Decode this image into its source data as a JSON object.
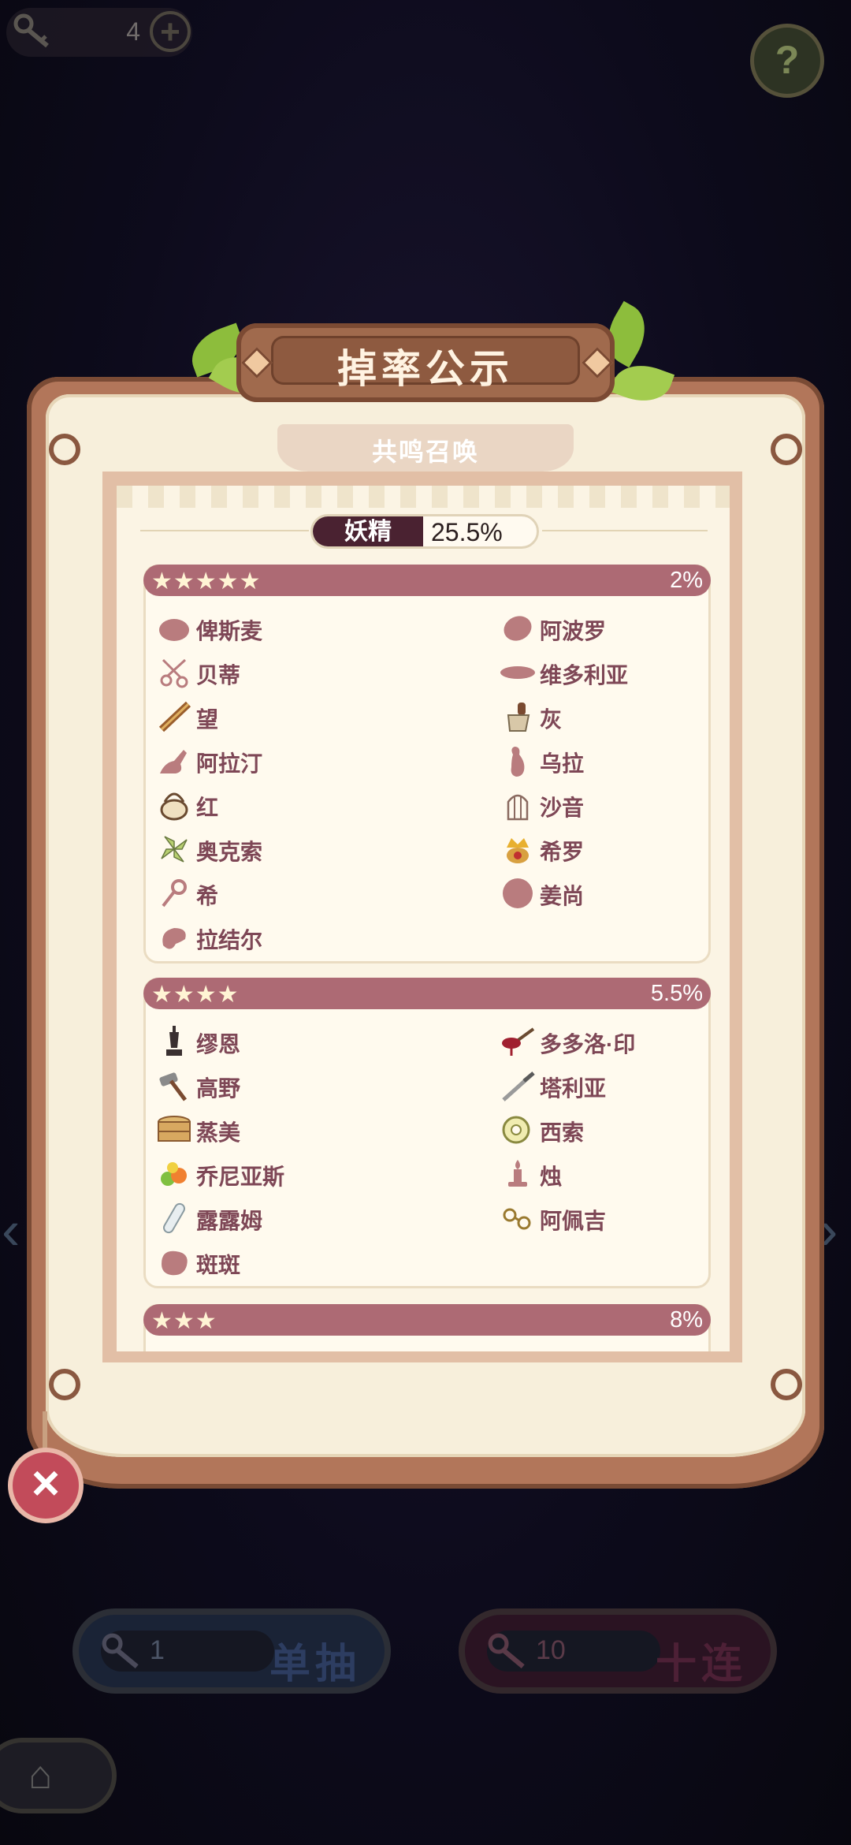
{
  "topbar": {
    "key_count": "4",
    "plus": "+",
    "help": "?"
  },
  "modal": {
    "title": "掉率公示",
    "subtitle": "共鸣召唤",
    "category": {
      "name": "妖精",
      "rate": "25.5%"
    },
    "tiers": [
      {
        "stars": "★★★★★",
        "rate": "2%",
        "items": [
          {
            "name": "俾斯麦",
            "icon": "blob-icon"
          },
          {
            "name": "阿波罗",
            "icon": "seed-icon"
          },
          {
            "name": "贝蒂",
            "icon": "scissors-icon"
          },
          {
            "name": "维多利亚",
            "icon": "pill-icon"
          },
          {
            "name": "望",
            "icon": "telescope-icon"
          },
          {
            "name": "灰",
            "icon": "brush-icon"
          },
          {
            "name": "阿拉汀",
            "icon": "lamp-icon"
          },
          {
            "name": "乌拉",
            "icon": "bowling-pin-icon"
          },
          {
            "name": "红",
            "icon": "basket-icon"
          },
          {
            "name": "沙音",
            "icon": "birdcage-icon"
          },
          {
            "name": "奥克索",
            "icon": "pinwheel-icon"
          },
          {
            "name": "希罗",
            "icon": "crown-icon"
          },
          {
            "name": "希",
            "icon": "key-icon"
          },
          {
            "name": "姜尚",
            "icon": "circle-icon"
          },
          {
            "name": "拉结尔",
            "icon": "blob-icon"
          }
        ]
      },
      {
        "stars": "★★★★",
        "rate": "5.5%",
        "items": [
          {
            "name": "缪恩",
            "icon": "chess-king-icon"
          },
          {
            "name": "多多洛·印",
            "icon": "ladle-icon"
          },
          {
            "name": "高野",
            "icon": "hammer-icon"
          },
          {
            "name": "塔利亚",
            "icon": "knife-icon"
          },
          {
            "name": "蒸美",
            "icon": "steamer-icon"
          },
          {
            "name": "西索",
            "icon": "tape-icon"
          },
          {
            "name": "乔尼亚斯",
            "icon": "fruit-icon"
          },
          {
            "name": "烛",
            "icon": "candle-icon"
          },
          {
            "name": "露露姆",
            "icon": "test-tube-icon"
          },
          {
            "name": "阿佩吉",
            "icon": "glasses-icon"
          },
          {
            "name": "斑斑",
            "icon": "blob-icon"
          }
        ]
      },
      {
        "stars": "★★★",
        "rate": "8%",
        "items": []
      }
    ]
  },
  "bottom": {
    "single": {
      "count": "1",
      "label": "单抽"
    },
    "ten": {
      "count": "10",
      "label": "十连"
    }
  },
  "colors": {
    "tier_bar": "#ad6a74",
    "item_text": "#7e4756",
    "frame": "#b2765a"
  }
}
